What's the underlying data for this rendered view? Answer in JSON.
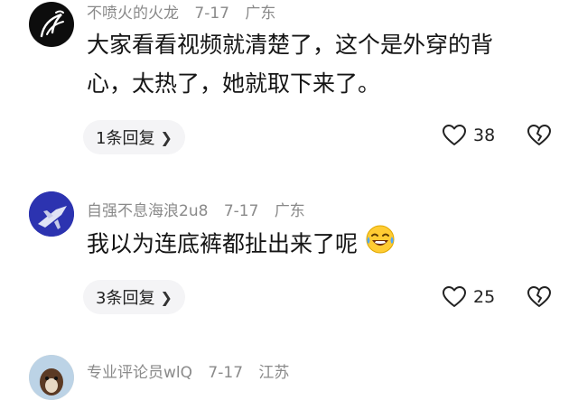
{
  "comments": [
    {
      "username": "不喷火的火龙",
      "date": "7-17",
      "location": "广东",
      "text_line1": "大家看看视频就清楚了，这个是外穿的背",
      "text_line2": "心，太热了，她就取下来了。",
      "reply_label": "1条回复",
      "likes": "38"
    },
    {
      "username": "自强不息海浪2u8",
      "date": "7-17",
      "location": "广东",
      "text": "我以为连底裤都扯出来了呢",
      "emoji": "laughing-with-tears",
      "reply_label": "3条回复",
      "likes": "25"
    },
    {
      "username": "专业评论员wlQ",
      "date": "7-17",
      "location": "江苏"
    }
  ],
  "colors": {
    "meta": "#8a8a8a",
    "reply_bg": "#f4f4f6",
    "text": "#151515"
  }
}
